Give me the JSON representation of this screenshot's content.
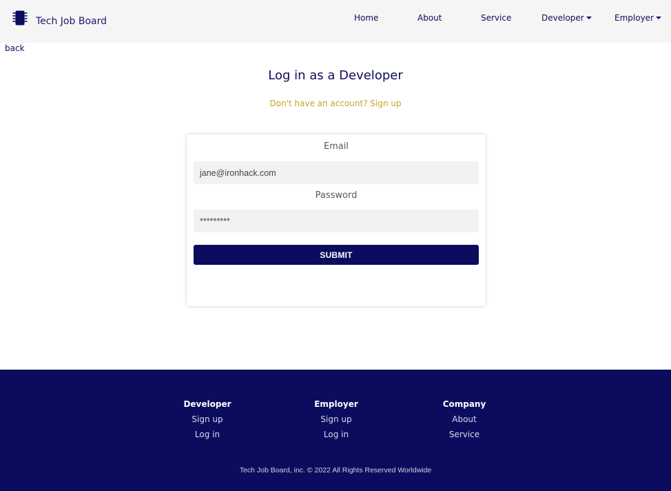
{
  "brand": {
    "name": "Tech Job Board",
    "icon": "chip-icon"
  },
  "nav": {
    "home": "Home",
    "about": "About",
    "service": "Service",
    "developer": "Developer",
    "employer": "Employer"
  },
  "back_link": "back",
  "login": {
    "title": "Log in as a Developer",
    "signup_prompt": "Don't have an account? Sign up",
    "email_label": "Email",
    "email_value": "jane@ironhack.com",
    "password_label": "Password",
    "password_value": "*********",
    "submit_label": "SUBMIT"
  },
  "footer": {
    "developer": {
      "heading": "Developer",
      "links": [
        "Sign up",
        "Log in"
      ]
    },
    "employer": {
      "heading": "Employer",
      "links": [
        "Sign up",
        "Log in"
      ]
    },
    "company": {
      "heading": "Company",
      "links": [
        "About",
        "Service"
      ]
    },
    "copyright": "Tech Job Board, inc. © 2022 All Rights Reserved Worldwide"
  },
  "colors": {
    "primary": "#0c0c5e",
    "accent": "#c9a227",
    "navbar_bg": "#f5f5f5",
    "input_bg": "#f2f2f2"
  }
}
